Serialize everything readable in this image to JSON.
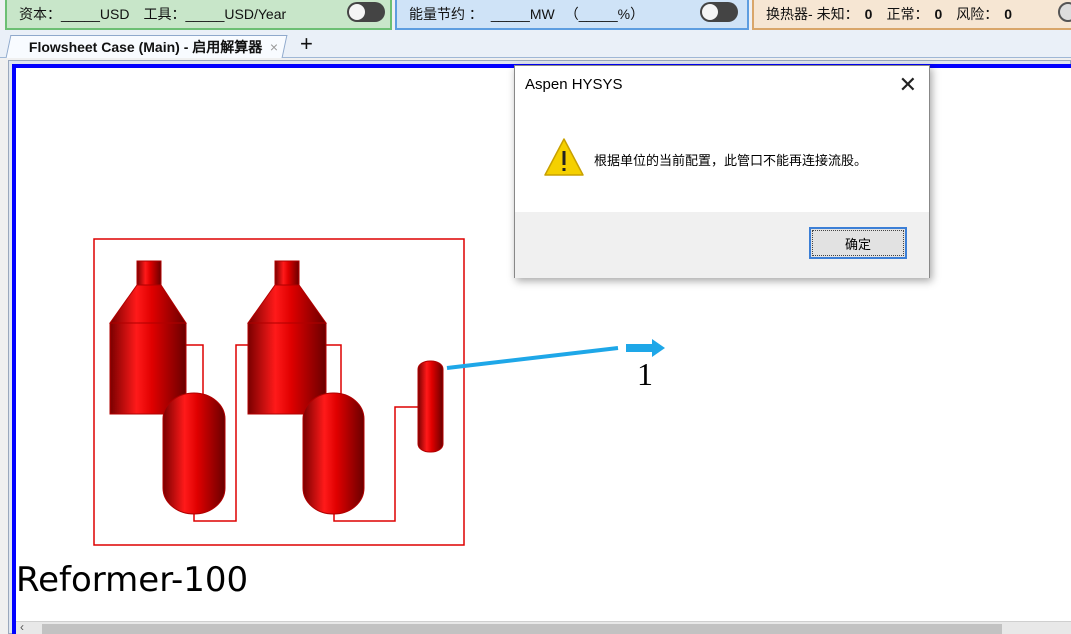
{
  "status_bar": {
    "cost": {
      "capital_label": "资本：",
      "capital_value": "_____USD",
      "utility_label": "工具：",
      "utility_value": "_____USD/Year"
    },
    "energy": {
      "label": "能量节约 ：",
      "value": "_____MW",
      "percent": "（_____%）"
    },
    "heat_exchangers": {
      "label": "换热器-",
      "unknown_label": "未知：",
      "unknown_count": "0",
      "normal_label": "正常：",
      "normal_count": "0",
      "risk_label": "风险：",
      "risk_count": "0"
    }
  },
  "tabs": [
    {
      "label": "Flowsheet Case (Main) - 启用解算器",
      "close": "×"
    }
  ],
  "tab_add": "+",
  "flowsheet": {
    "unit_operation": "Reformer-100",
    "stream_name": "1",
    "colors": {
      "equipment": "#dd0000",
      "stream": "#1ea7e8",
      "border": "#0000ff"
    }
  },
  "dialog": {
    "title": "Aspen HYSYS",
    "close": "✕",
    "icon": "warning-icon",
    "message": "根据单位的当前配置，此管口不能再连接流股。",
    "ok_label": "确定"
  },
  "scrollbar": {
    "left_arrow": "‹"
  }
}
